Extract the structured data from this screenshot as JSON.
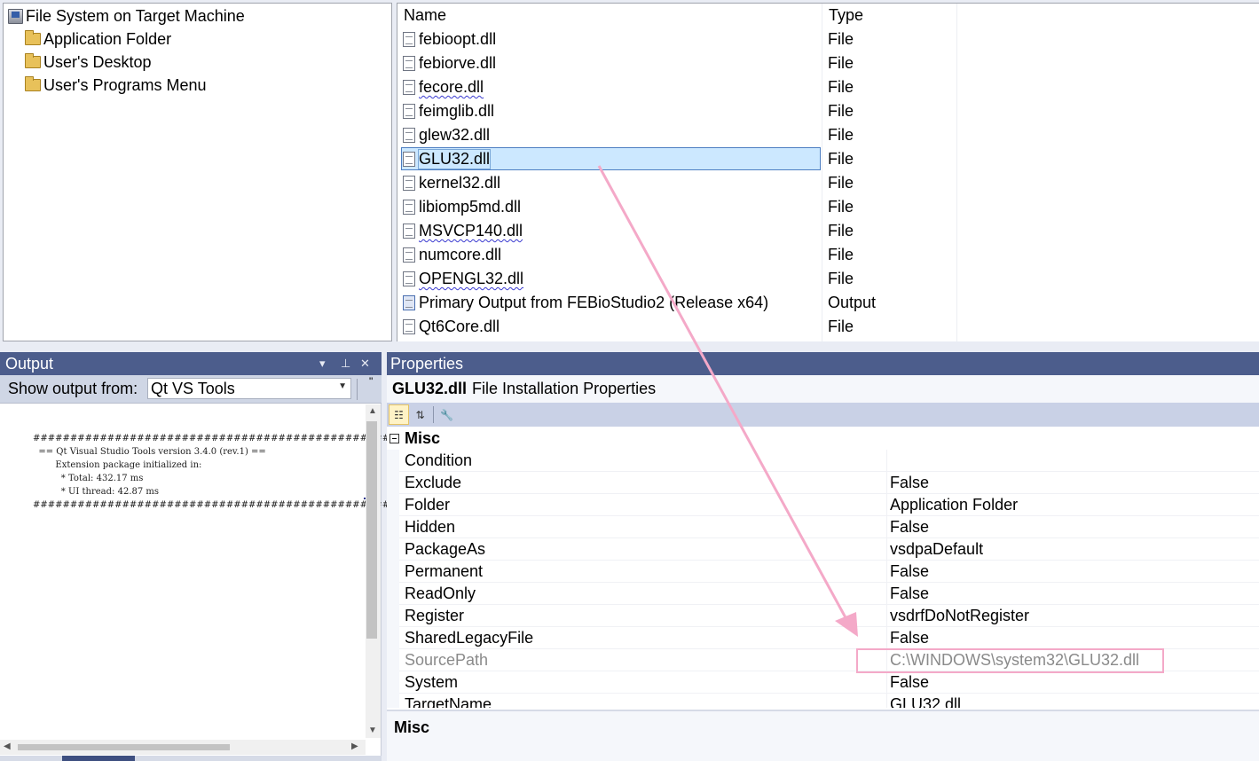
{
  "tree": {
    "root": "File System on Target Machine",
    "items": [
      "Application Folder",
      "User's Desktop",
      "User's Programs Menu"
    ]
  },
  "file_list": {
    "headers": {
      "name": "Name",
      "type": "Type"
    },
    "rows": [
      {
        "name": "febioopt.dll",
        "type": "File"
      },
      {
        "name": "febiorve.dll",
        "type": "File"
      },
      {
        "name": "fecore.dll",
        "type": "File"
      },
      {
        "name": "feimglib.dll",
        "type": "File"
      },
      {
        "name": "glew32.dll",
        "type": "File"
      },
      {
        "name": "GLU32.dll",
        "type": "File"
      },
      {
        "name": "kernel32.dll",
        "type": "File"
      },
      {
        "name": "libiomp5md.dll",
        "type": "File"
      },
      {
        "name": "MSVCP140.dll",
        "type": "File"
      },
      {
        "name": "numcore.dll",
        "type": "File"
      },
      {
        "name": "OPENGL32.dll",
        "type": "File"
      },
      {
        "name": "Primary Output from FEBioStudio2 (Release x64)",
        "type": "Output"
      },
      {
        "name": "Qt6Core.dll",
        "type": "File"
      }
    ],
    "selected": "GLU32.dll"
  },
  "output": {
    "title": "Output",
    "show_from_label": "Show output from:",
    "show_from_value": "Qt VS Tools",
    "lines": [
      "################################################################",
      "  == Qt Visual Studio Tools version 3.4.0 (rev.1) ==",
      "        Extension package initialized in:",
      "          * Total: 432.17 ms",
      "          * UI thread: 42.87 ms",
      "################################################################"
    ]
  },
  "properties": {
    "title": "Properties",
    "object_name": "GLU32.dll",
    "object_type": "File Installation Properties",
    "category": "Misc",
    "rows": [
      {
        "name": "Condition",
        "value": ""
      },
      {
        "name": "Exclude",
        "value": "False"
      },
      {
        "name": "Folder",
        "value": "Application Folder"
      },
      {
        "name": "Hidden",
        "value": "False"
      },
      {
        "name": "PackageAs",
        "value": "vsdpaDefault"
      },
      {
        "name": "Permanent",
        "value": "False"
      },
      {
        "name": "ReadOnly",
        "value": "False"
      },
      {
        "name": "Register",
        "value": "vsdrfDoNotRegister"
      },
      {
        "name": "SharedLegacyFile",
        "value": "False"
      },
      {
        "name": "SourcePath",
        "value": "C:\\WINDOWS\\system32\\GLU32.dll"
      },
      {
        "name": "System",
        "value": "False"
      },
      {
        "name": "TargetName",
        "value": "GLU32.dll"
      }
    ],
    "description_title": "Misc"
  },
  "colors": {
    "title_bar": "#4c5d8c",
    "selection": "#cce8ff",
    "annotation": "#f4a9c8"
  }
}
